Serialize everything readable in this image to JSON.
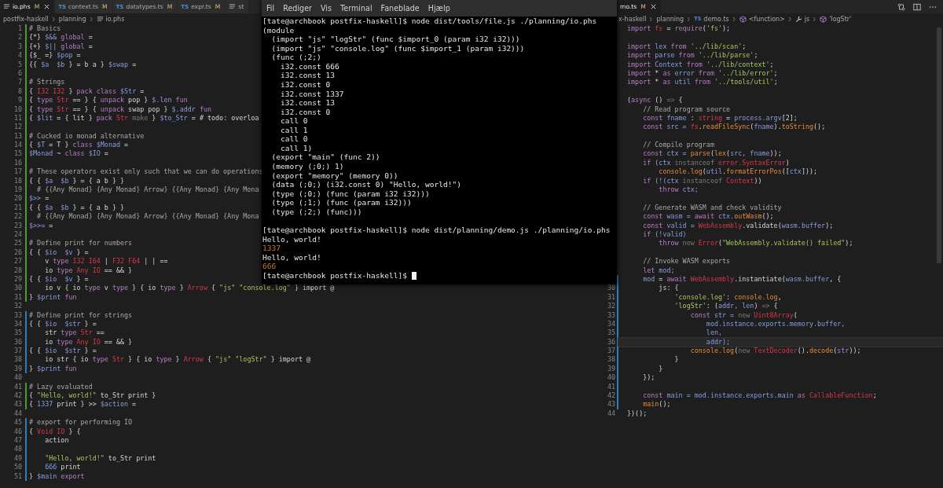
{
  "left_editor": {
    "tabs": [
      {
        "kind": "text",
        "label": "io.phs",
        "status": "M",
        "selected": true,
        "closable": true
      },
      {
        "kind": "ts",
        "badge": "TS",
        "label": "context.ts",
        "status": "M",
        "selected": false,
        "closable": false
      },
      {
        "kind": "ts",
        "badge": "TS",
        "label": "datatypes.ts",
        "status": "M",
        "selected": false,
        "closable": false
      },
      {
        "kind": "ts",
        "badge": "TS",
        "label": "expr.ts",
        "status": "M",
        "selected": false,
        "closable": false
      },
      {
        "kind": "text",
        "label": "st",
        "selected": false,
        "closable": false
      }
    ],
    "breadcrumb": [
      {
        "kind": "folder",
        "label": "postfix-haskell"
      },
      {
        "kind": "folder",
        "label": "planning"
      },
      {
        "kind": "text",
        "label": "io.phs"
      }
    ],
    "lines": [
      {
        "number": "1",
        "kind": "added",
        "segments": [
          {
            "text": "# Basics",
            "kind": "comment"
          }
        ]
      },
      {
        "number": "2",
        "kind": "added",
        "segments": [
          {
            "text": "{*} ",
            "kind": "plain"
          },
          {
            "text": "$&&",
            "kind": "var"
          },
          {
            "text": " global",
            "kind": "keyword"
          },
          {
            "text": " =",
            "kind": "plain"
          }
        ]
      },
      {
        "number": "3",
        "kind": "added",
        "segments": [
          {
            "text": "{+} ",
            "kind": "plain"
          },
          {
            "text": "$||",
            "kind": "var"
          },
          {
            "text": " global",
            "kind": "keyword"
          },
          {
            "text": " =",
            "kind": "plain"
          }
        ]
      },
      {
        "number": "4",
        "kind": "added",
        "segments": [
          {
            "text": "{$_ =} ",
            "kind": "plain"
          },
          {
            "text": "$pop",
            "kind": "var"
          },
          {
            "text": " =",
            "kind": "plain"
          }
        ]
      },
      {
        "number": "5",
        "kind": "added",
        "segments": [
          {
            "text": "{{ ",
            "kind": "plain"
          },
          {
            "text": "$a  $b",
            "kind": "var"
          },
          {
            "text": " } = b a } ",
            "kind": "plain"
          },
          {
            "text": "$swap",
            "kind": "var"
          },
          {
            "text": " =",
            "kind": "plain"
          }
        ]
      },
      {
        "number": "6",
        "kind": "added"
      },
      {
        "number": "7",
        "kind": "added",
        "segments": [
          {
            "text": "# Strings",
            "kind": "comment"
          }
        ]
      },
      {
        "number": "8",
        "kind": "added",
        "segments": [
          {
            "text": "{ ",
            "kind": "plain"
          },
          {
            "text": "I32 I32",
            "kind": "type"
          },
          {
            "text": " } ",
            "kind": "plain"
          },
          {
            "text": "pack class ",
            "kind": "keyword"
          },
          {
            "text": "$Str",
            "kind": "var"
          },
          {
            "text": " =",
            "kind": "plain"
          }
        ]
      },
      {
        "number": "9",
        "kind": "added",
        "segments": [
          {
            "text": "{ ",
            "kind": "plain"
          },
          {
            "text": "type ",
            "kind": "keyword"
          },
          {
            "text": "Str",
            "kind": "type"
          },
          {
            "text": " == } { ",
            "kind": "plain"
          },
          {
            "text": "unpack",
            "kind": "keyword"
          },
          {
            "text": " pop } ",
            "kind": "plain"
          },
          {
            "text": "$.len",
            "kind": "var"
          },
          {
            "text": " fun",
            "kind": "keyword"
          }
        ]
      },
      {
        "number": "10",
        "kind": "added",
        "segments": [
          {
            "text": "{ ",
            "kind": "plain"
          },
          {
            "text": "type ",
            "kind": "keyword"
          },
          {
            "text": "Str",
            "kind": "type"
          },
          {
            "text": " == } { ",
            "kind": "plain"
          },
          {
            "text": "unpack",
            "kind": "keyword"
          },
          {
            "text": " swap pop } ",
            "kind": "plain"
          },
          {
            "text": "$.addr",
            "kind": "var"
          },
          {
            "text": " fun",
            "kind": "keyword"
          }
        ]
      },
      {
        "number": "11",
        "kind": "added",
        "segments": [
          {
            "text": "{ ",
            "kind": "plain"
          },
          {
            "text": "$lit",
            "kind": "var"
          },
          {
            "text": " = { lit } ",
            "kind": "plain"
          },
          {
            "text": "pack ",
            "kind": "keyword"
          },
          {
            "text": "Str",
            "kind": "type"
          },
          {
            "text": " make",
            "kind": "dim"
          },
          {
            "text": " } ",
            "kind": "plain"
          },
          {
            "text": "$to_Str",
            "kind": "var"
          },
          {
            "text": " = # todo: overloa",
            "kind": "plain"
          }
        ]
      },
      {
        "number": "12",
        "kind": "added"
      },
      {
        "number": "13",
        "kind": "added",
        "segments": [
          {
            "text": "# Cucked io monad alternative",
            "kind": "comment"
          }
        ]
      },
      {
        "number": "14",
        "kind": "added",
        "segments": [
          {
            "text": "{ ",
            "kind": "plain"
          },
          {
            "text": "$T",
            "kind": "var"
          },
          {
            "text": " = T } ",
            "kind": "plain"
          },
          {
            "text": "class ",
            "kind": "keyword"
          },
          {
            "text": "$Monad",
            "kind": "var"
          },
          {
            "text": " =",
            "kind": "plain"
          }
        ]
      },
      {
        "number": "15",
        "kind": "added",
        "segments": [
          {
            "text": "$Monad",
            "kind": "var"
          },
          {
            "text": " ~ ",
            "kind": "plain"
          },
          {
            "text": "class ",
            "kind": "keyword"
          },
          {
            "text": "$IO",
            "kind": "var"
          },
          {
            "text": " =",
            "kind": "plain"
          }
        ]
      },
      {
        "number": "16",
        "kind": "added"
      },
      {
        "number": "17",
        "kind": "added",
        "segments": [
          {
            "text": "# These operators exist only such that we can do operations",
            "kind": "comment"
          }
        ]
      },
      {
        "number": "18",
        "kind": "added",
        "segments": [
          {
            "text": "{ { ",
            "kind": "plain"
          },
          {
            "text": "$a  $b",
            "kind": "var"
          },
          {
            "text": " } = { a b } }",
            "kind": "plain"
          }
        ]
      },
      {
        "number": "19",
        "kind": "added",
        "segments": [
          {
            "text": "  # {{Any Monad} {Any Monad} Arrow} {{Any Monad} {Any Mona",
            "kind": "comment"
          }
        ]
      },
      {
        "number": "20",
        "kind": "added",
        "segments": [
          {
            "text": "$>>",
            "kind": "var"
          },
          {
            "text": " =",
            "kind": "plain"
          }
        ]
      },
      {
        "number": "21",
        "kind": "added",
        "segments": [
          {
            "text": "{ { ",
            "kind": "plain"
          },
          {
            "text": "$a  $b",
            "kind": "var"
          },
          {
            "text": " } = { a b } }",
            "kind": "plain"
          }
        ]
      },
      {
        "number": "22",
        "kind": "added",
        "segments": [
          {
            "text": "  # {{Any Monad} {Any Monad} Arrow} {{Any Monad} {Any Mona",
            "kind": "comment"
          }
        ]
      },
      {
        "number": "23",
        "kind": "added",
        "segments": [
          {
            "text": "$>>=",
            "kind": "var"
          },
          {
            "text": " =",
            "kind": "plain"
          }
        ]
      },
      {
        "number": "24",
        "kind": "added"
      },
      {
        "number": "25",
        "kind": "added",
        "segments": [
          {
            "text": "# Define print for numbers",
            "kind": "comment"
          }
        ]
      },
      {
        "number": "26",
        "kind": "added",
        "segments": [
          {
            "text": "{ { ",
            "kind": "plain"
          },
          {
            "text": "$io  $v",
            "kind": "var"
          },
          {
            "text": " } =",
            "kind": "plain"
          }
        ]
      },
      {
        "number": "27",
        "kind": "added",
        "segments": [
          {
            "text": "    v ",
            "kind": "plain"
          },
          {
            "text": "type ",
            "kind": "keyword"
          },
          {
            "text": "I32 I64",
            "kind": "type"
          },
          {
            "text": " | ",
            "kind": "plain"
          },
          {
            "text": "F32 F64",
            "kind": "type"
          },
          {
            "text": " | | ==",
            "kind": "plain"
          }
        ]
      },
      {
        "number": "28",
        "kind": "added",
        "segments": [
          {
            "text": "    io ",
            "kind": "plain"
          },
          {
            "text": "type ",
            "kind": "keyword"
          },
          {
            "text": "Any IO",
            "kind": "type"
          },
          {
            "text": " == && }",
            "kind": "plain"
          }
        ]
      },
      {
        "number": "29",
        "kind": "added",
        "segments": [
          {
            "text": "{ { ",
            "kind": "plain"
          },
          {
            "text": "$io  $v",
            "kind": "var"
          },
          {
            "text": " } =",
            "kind": "plain"
          }
        ]
      },
      {
        "number": "30",
        "kind": "added",
        "segments": [
          {
            "text": "    io v { io ",
            "kind": "plain"
          },
          {
            "text": "type",
            "kind": "keyword"
          },
          {
            "text": " v ",
            "kind": "plain"
          },
          {
            "text": "type",
            "kind": "keyword"
          },
          {
            "text": " } { io ",
            "kind": "plain"
          },
          {
            "text": "type",
            "kind": "keyword"
          },
          {
            "text": " } ",
            "kind": "plain"
          },
          {
            "text": "Arrow",
            "kind": "type"
          },
          {
            "text": " { ",
            "kind": "plain"
          },
          {
            "text": "\"js\" \"console.log\"",
            "kind": "string"
          },
          {
            "text": " } import @",
            "kind": "plain"
          }
        ]
      },
      {
        "number": "31",
        "kind": "added",
        "segments": [
          {
            "text": "} ",
            "kind": "plain"
          },
          {
            "text": "$print",
            "kind": "var"
          },
          {
            "text": " fun",
            "kind": "keyword"
          }
        ]
      },
      {
        "number": "32",
        "kind": "plain"
      },
      {
        "number": "33",
        "kind": "modified",
        "segments": [
          {
            "text": "# Define print for strings",
            "kind": "comment"
          }
        ]
      },
      {
        "number": "34",
        "kind": "modified",
        "segments": [
          {
            "text": "{ { ",
            "kind": "plain"
          },
          {
            "text": "$io  $str",
            "kind": "var"
          },
          {
            "text": " } =",
            "kind": "plain"
          }
        ]
      },
      {
        "number": "35",
        "kind": "modified",
        "segments": [
          {
            "text": "    str ",
            "kind": "plain"
          },
          {
            "text": "type ",
            "kind": "keyword"
          },
          {
            "text": "Str",
            "kind": "type"
          },
          {
            "text": " ==",
            "kind": "plain"
          }
        ]
      },
      {
        "number": "36",
        "kind": "modified",
        "segments": [
          {
            "text": "    io ",
            "kind": "plain"
          },
          {
            "text": "type ",
            "kind": "keyword"
          },
          {
            "text": "Any IO",
            "kind": "type"
          },
          {
            "text": " == && }",
            "kind": "plain"
          }
        ]
      },
      {
        "number": "37",
        "kind": "modified",
        "segments": [
          {
            "text": "{ { ",
            "kind": "plain"
          },
          {
            "text": "$io  $str",
            "kind": "var"
          },
          {
            "text": " } =",
            "kind": "plain"
          }
        ]
      },
      {
        "number": "38",
        "kind": "modified",
        "segments": [
          {
            "text": "    io str { io ",
            "kind": "plain"
          },
          {
            "text": "type ",
            "kind": "keyword"
          },
          {
            "text": "Str",
            "kind": "type"
          },
          {
            "text": " } { io ",
            "kind": "plain"
          },
          {
            "text": "type",
            "kind": "keyword"
          },
          {
            "text": " } ",
            "kind": "plain"
          },
          {
            "text": "Arrow",
            "kind": "type"
          },
          {
            "text": " { ",
            "kind": "plain"
          },
          {
            "text": "\"js\" \"logStr\"",
            "kind": "string"
          },
          {
            "text": " } import @",
            "kind": "plain"
          }
        ]
      },
      {
        "number": "39",
        "kind": "modified",
        "segments": [
          {
            "text": "} ",
            "kind": "plain"
          },
          {
            "text": "$print",
            "kind": "var"
          },
          {
            "text": " fun",
            "kind": "keyword"
          }
        ]
      },
      {
        "number": "40",
        "kind": "plain"
      },
      {
        "number": "41",
        "kind": "added",
        "segments": [
          {
            "text": "# Lazy evaluated",
            "kind": "comment"
          }
        ]
      },
      {
        "number": "42",
        "kind": "added",
        "segments": [
          {
            "text": "{ ",
            "kind": "plain"
          },
          {
            "text": "\"Hello, world!\"",
            "kind": "string"
          },
          {
            "text": " to_Str print }",
            "kind": "plain"
          }
        ]
      },
      {
        "number": "43",
        "kind": "added",
        "segments": [
          {
            "text": "{ ",
            "kind": "plain"
          },
          {
            "text": "1337",
            "kind": "number"
          },
          {
            "text": " print } >> ",
            "kind": "plain"
          },
          {
            "text": "$action",
            "kind": "var"
          },
          {
            "text": " =",
            "kind": "plain"
          }
        ]
      },
      {
        "number": "44",
        "kind": "plain"
      },
      {
        "number": "45",
        "kind": "modified",
        "segments": [
          {
            "text": "# export for performing IO",
            "kind": "comment"
          }
        ]
      },
      {
        "number": "46",
        "kind": "modified",
        "segments": [
          {
            "text": "{ ",
            "kind": "plain"
          },
          {
            "text": "Void IO",
            "kind": "type"
          },
          {
            "text": " } {",
            "kind": "plain"
          }
        ]
      },
      {
        "number": "47",
        "kind": "modified",
        "segments": [
          {
            "text": "    action",
            "kind": "plain"
          }
        ]
      },
      {
        "number": "48",
        "kind": "modified"
      },
      {
        "number": "49",
        "kind": "modified",
        "segments": [
          {
            "text": "    \"Hello, world!\"",
            "kind": "string"
          },
          {
            "text": " to_Str print",
            "kind": "plain"
          }
        ]
      },
      {
        "number": "50",
        "kind": "modified",
        "segments": [
          {
            "text": "    666",
            "kind": "number"
          },
          {
            "text": " print",
            "kind": "plain"
          }
        ]
      },
      {
        "number": "51",
        "kind": "modified",
        "segments": [
          {
            "text": "} ",
            "kind": "plain"
          },
          {
            "text": "$main",
            "kind": "var"
          },
          {
            "text": " export",
            "kind": "keyword"
          }
        ]
      }
    ]
  },
  "right_editor": {
    "tabs": [
      {
        "label": "mo.ts",
        "status": "M",
        "selected": true,
        "closable": true
      }
    ],
    "breadcrumb": [
      {
        "kind": "folder",
        "label": "x-haskell"
      },
      {
        "kind": "folder",
        "label": "planning"
      },
      {
        "kind": "ts",
        "label": "demo.ts",
        "badge": "TS"
      },
      {
        "kind": "function",
        "label": "<function>"
      },
      {
        "kind": "property",
        "label": "js"
      },
      {
        "kind": "function",
        "label": "'logStr'"
      }
    ],
    "lines": [
      {
        "kind": "plain",
        "segments": [
          {
            "text": "import ",
            "kind": "keyword"
          },
          {
            "text": "fs",
            "kind": "type"
          },
          {
            "text": " = ",
            "kind": "plain"
          },
          {
            "text": "require",
            "kind": "keyword"
          },
          {
            "text": "(",
            "kind": "plain"
          },
          {
            "text": "'fs'",
            "kind": "string"
          },
          {
            "text": ");",
            "kind": "plain"
          }
        ]
      },
      {
        "kind": "plain"
      },
      {
        "kind": "plain",
        "segments": [
          {
            "text": "import",
            "kind": "keyword"
          },
          {
            "text": " lex ",
            "kind": "var"
          },
          {
            "text": "from ",
            "kind": "keyword"
          },
          {
            "text": "'../lib/scan'",
            "kind": "string"
          },
          {
            "text": ";",
            "kind": "plain"
          }
        ]
      },
      {
        "kind": "plain",
        "segments": [
          {
            "text": "import",
            "kind": "keyword"
          },
          {
            "text": " parse ",
            "kind": "var"
          },
          {
            "text": "from ",
            "kind": "keyword"
          },
          {
            "text": "'../lib/parse'",
            "kind": "string"
          },
          {
            "text": ";",
            "kind": "plain"
          }
        ]
      },
      {
        "kind": "plain",
        "segments": [
          {
            "text": "import",
            "kind": "keyword"
          },
          {
            "text": " Context ",
            "kind": "var"
          },
          {
            "text": "from ",
            "kind": "keyword"
          },
          {
            "text": "'../lib/context'",
            "kind": "string"
          },
          {
            "text": ";",
            "kind": "plain"
          }
        ]
      },
      {
        "kind": "plain",
        "segments": [
          {
            "text": "import",
            "kind": "keyword"
          },
          {
            "text": " * ",
            "kind": "plain"
          },
          {
            "text": "as",
            "kind": "keyword"
          },
          {
            "text": " error ",
            "kind": "var"
          },
          {
            "text": "from ",
            "kind": "keyword"
          },
          {
            "text": "'../lib/error'",
            "kind": "string"
          },
          {
            "text": ";",
            "kind": "plain"
          }
        ]
      },
      {
        "kind": "plain",
        "segments": [
          {
            "text": "import",
            "kind": "keyword"
          },
          {
            "text": " * ",
            "kind": "plain"
          },
          {
            "text": "as",
            "kind": "keyword"
          },
          {
            "text": " util ",
            "kind": "var"
          },
          {
            "text": "from ",
            "kind": "keyword"
          },
          {
            "text": "'../tools/util'",
            "kind": "string"
          },
          {
            "text": ";",
            "kind": "plain"
          }
        ]
      },
      {
        "kind": "plain"
      },
      {
        "kind": "plain",
        "segments": [
          {
            "text": "(",
            "kind": "plain"
          },
          {
            "text": "async",
            "kind": "keyword"
          },
          {
            "text": " () ",
            "kind": "plain"
          },
          {
            "text": "=>",
            "kind": "dim"
          },
          {
            "text": " {",
            "kind": "plain"
          }
        ]
      },
      {
        "kind": "plain",
        "segments": [
          {
            "text": "    // Read program source",
            "kind": "comment"
          }
        ]
      },
      {
        "kind": "plain",
        "segments": [
          {
            "text": "    const",
            "kind": "keyword"
          },
          {
            "text": " fname ",
            "kind": "var"
          },
          {
            "text": ": ",
            "kind": "plain"
          },
          {
            "text": "string",
            "kind": "type"
          },
          {
            "text": " = ",
            "kind": "plain"
          },
          {
            "text": "process.argv",
            "kind": "var"
          },
          {
            "text": "[2];",
            "kind": "plain"
          }
        ]
      },
      {
        "kind": "plain",
        "segments": [
          {
            "text": "    const",
            "kind": "keyword"
          },
          {
            "text": " src = ",
            "kind": "var"
          },
          {
            "text": "fs",
            "kind": "type"
          },
          {
            "text": ".",
            "kind": "plain"
          },
          {
            "text": "readFileSync",
            "kind": "function"
          },
          {
            "text": "(",
            "kind": "plain"
          },
          {
            "text": "fname",
            "kind": "var"
          },
          {
            "text": ").",
            "kind": "plain"
          },
          {
            "text": "toString",
            "kind": "function"
          },
          {
            "text": "();",
            "kind": "plain"
          }
        ]
      },
      {
        "kind": "plain"
      },
      {
        "kind": "plain",
        "segments": [
          {
            "text": "    // Compile program",
            "kind": "comment"
          }
        ]
      },
      {
        "kind": "plain",
        "segments": [
          {
            "text": "    const",
            "kind": "keyword"
          },
          {
            "text": " ctx = ",
            "kind": "var"
          },
          {
            "text": "parse",
            "kind": "function"
          },
          {
            "text": "(",
            "kind": "plain"
          },
          {
            "text": "lex",
            "kind": "function"
          },
          {
            "text": "(",
            "kind": "plain"
          },
          {
            "text": "src, fname",
            "kind": "var"
          },
          {
            "text": "));",
            "kind": "plain"
          }
        ]
      },
      {
        "kind": "plain",
        "segments": [
          {
            "text": "    if",
            "kind": "keyword"
          },
          {
            "text": " (ctx ",
            "kind": "var"
          },
          {
            "text": "instanceof ",
            "kind": "dim"
          },
          {
            "text": "error.SyntaxError",
            "kind": "type"
          },
          {
            "text": ")",
            "kind": "plain"
          }
        ]
      },
      {
        "kind": "plain",
        "segments": [
          {
            "text": "        console.log",
            "kind": "function"
          },
          {
            "text": "(",
            "kind": "plain"
          },
          {
            "text": "util",
            "kind": "var"
          },
          {
            "text": ".",
            "kind": "plain"
          },
          {
            "text": "formatErrorPos",
            "kind": "function"
          },
          {
            "text": "([",
            "kind": "plain"
          },
          {
            "text": "ctx",
            "kind": "var"
          },
          {
            "text": "]));",
            "kind": "plain"
          }
        ]
      },
      {
        "kind": "plain",
        "segments": [
          {
            "text": "    if",
            "kind": "keyword"
          },
          {
            "text": " (!(ctx ",
            "kind": "var"
          },
          {
            "text": "instanceof ",
            "kind": "dim"
          },
          {
            "text": "Context",
            "kind": "type"
          },
          {
            "text": "))",
            "kind": "plain"
          }
        ]
      },
      {
        "kind": "plain",
        "segments": [
          {
            "text": "        throw",
            "kind": "keyword"
          },
          {
            "text": " ctx;",
            "kind": "var"
          }
        ]
      },
      {
        "kind": "plain"
      },
      {
        "kind": "plain",
        "segments": [
          {
            "text": "    // Generate WASM and check validity",
            "kind": "comment"
          }
        ]
      },
      {
        "kind": "plain",
        "segments": [
          {
            "text": "    const",
            "kind": "keyword"
          },
          {
            "text": " wasm = ",
            "kind": "var"
          },
          {
            "text": "await",
            "kind": "keyword"
          },
          {
            "text": " ctx.",
            "kind": "var"
          },
          {
            "text": "outWasm",
            "kind": "function"
          },
          {
            "text": "();",
            "kind": "plain"
          }
        ]
      },
      {
        "kind": "plain",
        "segments": [
          {
            "text": "    const",
            "kind": "keyword"
          },
          {
            "text": " valid = ",
            "kind": "var"
          },
          {
            "text": "WebAssembly",
            "kind": "type"
          },
          {
            "text": ".validate(",
            "kind": "plain"
          },
          {
            "text": "wasm.buffer",
            "kind": "var"
          },
          {
            "text": ");",
            "kind": "plain"
          }
        ]
      },
      {
        "kind": "plain",
        "segments": [
          {
            "text": "    if",
            "kind": "keyword"
          },
          {
            "text": " (!valid)",
            "kind": "var"
          }
        ]
      },
      {
        "kind": "plain",
        "segments": [
          {
            "text": "        throw ",
            "kind": "keyword"
          },
          {
            "text": "new ",
            "kind": "dim"
          },
          {
            "text": "Error",
            "kind": "type"
          },
          {
            "text": "(",
            "kind": "plain"
          },
          {
            "text": "\"WebAssembly.validate() failed\"",
            "kind": "string"
          },
          {
            "text": ");",
            "kind": "plain"
          }
        ]
      },
      {
        "kind": "plain"
      },
      {
        "kind": "plain",
        "segments": [
          {
            "text": "    // Invoke WASM exports",
            "kind": "comment"
          }
        ]
      },
      {
        "kind": "plain",
        "segments": [
          {
            "text": "    let",
            "kind": "keyword"
          },
          {
            "text": " mod;",
            "kind": "var"
          }
        ]
      },
      {
        "kind": "modified",
        "segments": [
          {
            "text": "    mod",
            "kind": "var"
          },
          {
            "text": " = ",
            "kind": "plain"
          },
          {
            "text": "await ",
            "kind": "keyword"
          },
          {
            "text": "WebAssembly",
            "kind": "type"
          },
          {
            "text": ".instantiate(",
            "kind": "plain"
          },
          {
            "text": "wasm.buffer",
            "kind": "var"
          },
          {
            "text": ", {",
            "kind": "plain"
          }
        ]
      },
      {
        "number": "30",
        "kind": "modified",
        "segments": [
          {
            "text": "        js: {",
            "kind": "plain"
          }
        ]
      },
      {
        "number": "31",
        "kind": "modified",
        "segments": [
          {
            "text": "            'console.log'",
            "kind": "string"
          },
          {
            "text": ": ",
            "kind": "plain"
          },
          {
            "text": "console.log",
            "kind": "function"
          },
          {
            "text": ",",
            "kind": "plain"
          }
        ]
      },
      {
        "number": "32",
        "kind": "modified",
        "segments": [
          {
            "text": "            'logStr'",
            "kind": "string"
          },
          {
            "text": ": (",
            "kind": "plain"
          },
          {
            "text": "addr, len",
            "kind": "var"
          },
          {
            "text": ") ",
            "kind": "plain"
          },
          {
            "text": "=>",
            "kind": "dim"
          },
          {
            "text": " {",
            "kind": "plain"
          }
        ]
      },
      {
        "number": "33",
        "kind": "modified",
        "segments": [
          {
            "text": "                const",
            "kind": "keyword"
          },
          {
            "text": " str = ",
            "kind": "var"
          },
          {
            "text": "new ",
            "kind": "dim"
          },
          {
            "text": "Uint8Array",
            "kind": "type"
          },
          {
            "text": "(",
            "kind": "plain"
          }
        ]
      },
      {
        "number": "34",
        "kind": "modified",
        "segments": [
          {
            "text": "                    mod.instance.exports.memory.buffer,",
            "kind": "var"
          }
        ]
      },
      {
        "number": "35",
        "kind": "modified",
        "segments": [
          {
            "text": "                    len,",
            "kind": "var"
          }
        ]
      },
      {
        "number": "36",
        "kind": "modified",
        "current": true,
        "segments": [
          {
            "text": "                    addr);",
            "kind": "var"
          }
        ]
      },
      {
        "number": "37",
        "kind": "modified",
        "segments": [
          {
            "text": "                console.log",
            "kind": "function"
          },
          {
            "text": "(",
            "kind": "plain"
          },
          {
            "text": "new ",
            "kind": "dim"
          },
          {
            "text": "TextDecoder",
            "kind": "type"
          },
          {
            "text": "().",
            "kind": "plain"
          },
          {
            "text": "decode",
            "kind": "function"
          },
          {
            "text": "(",
            "kind": "plain"
          },
          {
            "text": "str",
            "kind": "var"
          },
          {
            "text": "));",
            "kind": "plain"
          }
        ]
      },
      {
        "number": "38",
        "kind": "modified",
        "segments": [
          {
            "text": "            }",
            "kind": "plain"
          }
        ]
      },
      {
        "number": "39",
        "kind": "modified",
        "segments": [
          {
            "text": "        }",
            "kind": "plain"
          }
        ]
      },
      {
        "number": "40",
        "kind": "modified",
        "segments": [
          {
            "text": "    });",
            "kind": "plain"
          }
        ]
      },
      {
        "number": "41",
        "kind": "modified"
      },
      {
        "number": "42",
        "kind": "modified",
        "segments": [
          {
            "text": "    const",
            "kind": "keyword"
          },
          {
            "text": " main = mod.instance.exports.main ",
            "kind": "var"
          },
          {
            "text": "as ",
            "kind": "keyword"
          },
          {
            "text": "CallableFunction",
            "kind": "type"
          },
          {
            "text": ";",
            "kind": "plain"
          }
        ]
      },
      {
        "number": "43",
        "kind": "modified",
        "segments": [
          {
            "text": "    main",
            "kind": "function"
          },
          {
            "text": "();",
            "kind": "plain"
          }
        ]
      },
      {
        "number": "44",
        "kind": "plain",
        "segments": [
          {
            "text": "})();",
            "kind": "plain"
          }
        ]
      }
    ]
  },
  "terminal": {
    "menu": [
      "Fil",
      "Rediger",
      "Vis",
      "Terminal",
      "Faneblade",
      "Hjælp"
    ],
    "cursor_visible": true,
    "lines": [
      {
        "text": "[tate@archbook postfix-haskell]$ node dist/tools/file.js ./planning/io.phs",
        "kind": "output"
      },
      {
        "text": "(module",
        "kind": "output"
      },
      {
        "text": "  (import \"js\" \"logStr\" (func $import_0 (param i32 i32)))",
        "kind": "output"
      },
      {
        "text": "  (import \"js\" \"console.log\" (func $import_1 (param i32)))",
        "kind": "output"
      },
      {
        "text": "  (func (;2;)",
        "kind": "output"
      },
      {
        "text": "    i32.const 666",
        "kind": "output"
      },
      {
        "text": "    i32.const 13",
        "kind": "output"
      },
      {
        "text": "    i32.const 0",
        "kind": "output"
      },
      {
        "text": "    i32.const 1337",
        "kind": "output"
      },
      {
        "text": "    i32.const 13",
        "kind": "output"
      },
      {
        "text": "    i32.const 0",
        "kind": "output"
      },
      {
        "text": "    call 0",
        "kind": "output"
      },
      {
        "text": "    call 1",
        "kind": "output"
      },
      {
        "text": "    call 0",
        "kind": "output"
      },
      {
        "text": "    call 1)",
        "kind": "output"
      },
      {
        "text": "  (export \"main\" (func 2))",
        "kind": "output"
      },
      {
        "text": "  (memory (;0;) 1)",
        "kind": "output"
      },
      {
        "text": "  (export \"memory\" (memory 0))",
        "kind": "output"
      },
      {
        "text": "  (data (;0;) (i32.const 0) \"Hello, world!\")",
        "kind": "output"
      },
      {
        "text": "  (type (;0;) (func (param i32 i32)))",
        "kind": "output"
      },
      {
        "text": "  (type (;1;) (func (param i32)))",
        "kind": "output"
      },
      {
        "text": "  (type (;2;) (func)))",
        "kind": "output"
      },
      {
        "kind": "blank"
      },
      {
        "text": "[tate@archbook postfix-haskell]$ node dist/planning/demo.js ./planning/io.phs",
        "kind": "output"
      },
      {
        "text": "Hello, world!",
        "kind": "output"
      },
      {
        "text": "1337",
        "kind": "number"
      },
      {
        "text": "Hello, world!",
        "kind": "output"
      },
      {
        "text": "666",
        "kind": "number"
      },
      {
        "text": "[tate@archbook postfix-haskell]$",
        "kind": "output"
      }
    ]
  }
}
